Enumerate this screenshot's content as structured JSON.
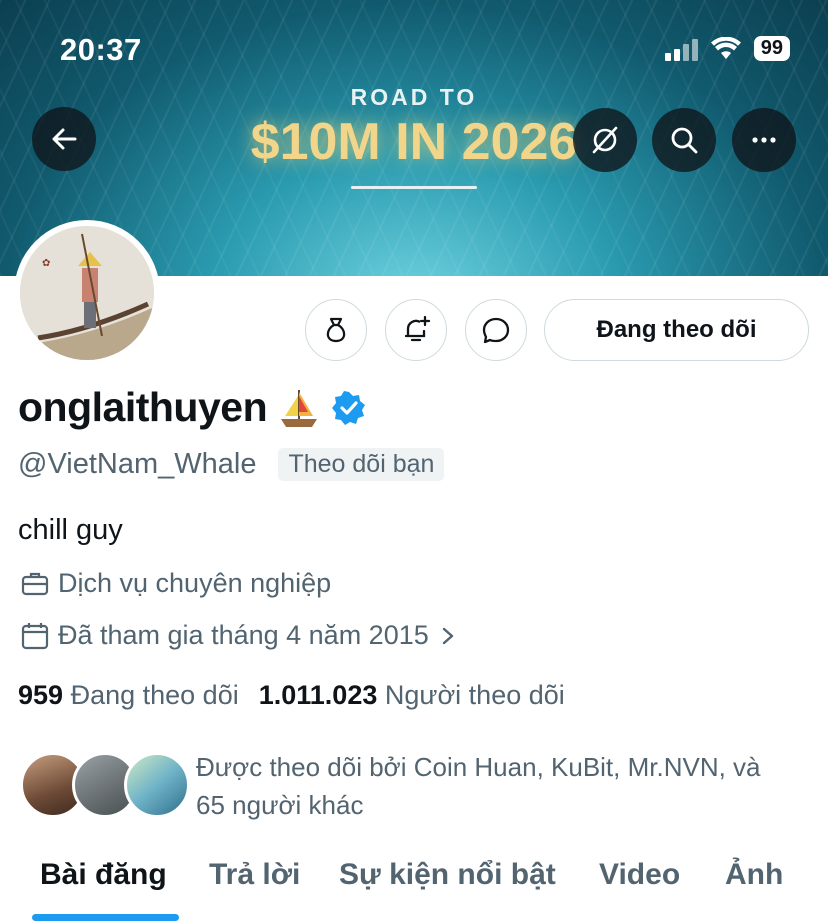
{
  "status_bar": {
    "time": "20:37",
    "battery": "99"
  },
  "banner": {
    "line1": "ROAD TO",
    "line2": "$10M IN 2026"
  },
  "profile": {
    "display_name": "onglaithuyen",
    "handle": "@VietNam_Whale",
    "follows_you": "Theo dõi bạn",
    "bio": "chill guy",
    "category": "Dịch vụ chuyên nghiệp",
    "joined": "Đã tham gia tháng 4 năm 2015"
  },
  "actions": {
    "follow_label": "Đang theo dõi"
  },
  "stats": {
    "following_count": "959",
    "following_label": "Đang theo dõi",
    "followers_count": "1.011.023",
    "followers_label": "Người theo dõi"
  },
  "followed_by": {
    "line1": "Được theo dõi bởi Coin Huan, KuBit, Mr.NVN, và",
    "line2": "65 người khác"
  },
  "tabs": [
    {
      "label": "Bài đăng"
    },
    {
      "label": "Trả lời"
    },
    {
      "label": "Sự kiện nổi bật"
    },
    {
      "label": "Video"
    },
    {
      "label": "Ảnh"
    }
  ],
  "colors": {
    "accent": "#1d9bf0",
    "text_primary": "#0f1419",
    "text_secondary": "#536471",
    "banner_title": "#f1d58a"
  },
  "icons": [
    "back-arrow-icon",
    "grok-icon",
    "search-icon",
    "more-icon",
    "money-bag-icon",
    "bell-plus-icon",
    "message-icon",
    "sailboat-icon",
    "verified-badge-icon",
    "briefcase-icon",
    "calendar-icon",
    "chevron-right-icon"
  ]
}
